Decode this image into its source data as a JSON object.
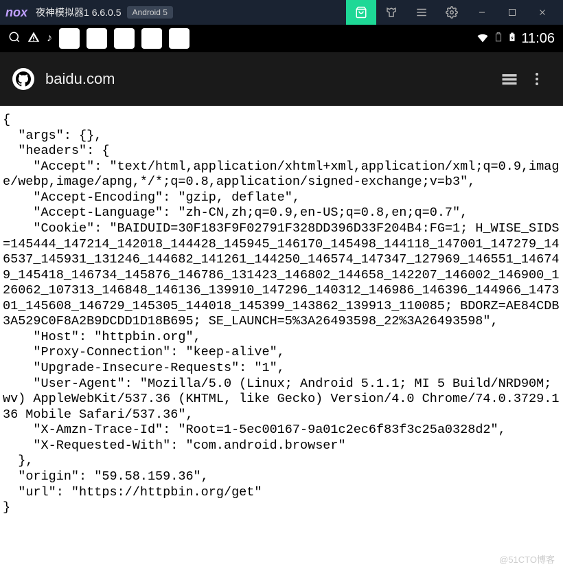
{
  "titlebar": {
    "logo": "nox",
    "title": "夜神模拟器1 6.6.0.5",
    "android_badge": "Android 5"
  },
  "statusbar": {
    "time": "11:06"
  },
  "addressbar": {
    "url": "baidu.com"
  },
  "content_json": "{\n  \"args\": {},\n  \"headers\": {\n    \"Accept\": \"text/html,application/xhtml+xml,application/xml;q=0.9,image/webp,image/apng,*/*;q=0.8,application/signed-exchange;v=b3\",\n    \"Accept-Encoding\": \"gzip, deflate\",\n    \"Accept-Language\": \"zh-CN,zh;q=0.9,en-US;q=0.8,en;q=0.7\",\n    \"Cookie\": \"BAIDUID=30F183F9F02791F328DD396D33F204B4:FG=1; H_WISE_SIDS=145444_147214_142018_144428_145945_146170_145498_144118_147001_147279_146537_145931_131246_144682_141261_144250_146574_147347_127969_146551_146749_145418_146734_145876_146786_131423_146802_144658_142207_146002_146900_126062_107313_146848_146136_139910_147296_140312_146986_146396_144966_147301_145608_146729_145305_144018_145399_143862_139913_110085; BDORZ=AE84CDB3A529C0F8A2B9DCDD1D18B695; SE_LAUNCH=5%3A26493598_22%3A26493598\",\n    \"Host\": \"httpbin.org\",\n    \"Proxy-Connection\": \"keep-alive\",\n    \"Upgrade-Insecure-Requests\": \"1\",\n    \"User-Agent\": \"Mozilla/5.0 (Linux; Android 5.1.1; MI 5 Build/NRD90M; wv) AppleWebKit/537.36 (KHTML, like Gecko) Version/4.0 Chrome/74.0.3729.136 Mobile Safari/537.36\",\n    \"X-Amzn-Trace-Id\": \"Root=1-5ec00167-9a01c2ec6f83f3c25a0328d2\",\n    \"X-Requested-With\": \"com.android.browser\"\n  },\n  \"origin\": \"59.58.159.36\",\n  \"url\": \"https://httpbin.org/get\"\n}",
  "watermark": "@51CTO博客"
}
